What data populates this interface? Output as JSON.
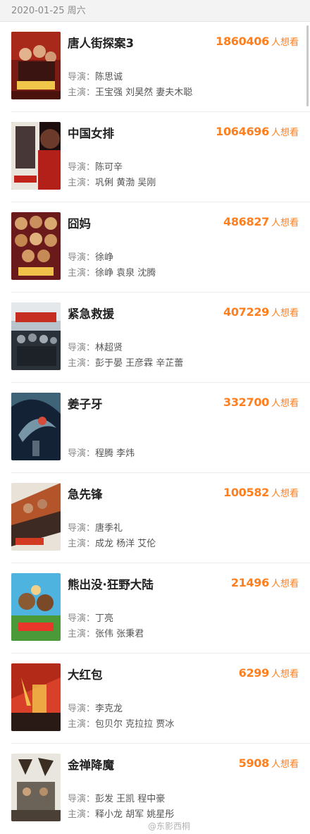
{
  "header": {
    "date": "2020-01-25 周六"
  },
  "wish_suffix": "人想看",
  "director_label": "导演：",
  "cast_label": "主演：",
  "accent_color": "#ff7f1f",
  "movies": [
    {
      "title": "唐人街探案3",
      "wish_count": "1860406",
      "director": "陈思诚",
      "cast": "王宝强 刘昊然 妻夫木聪"
    },
    {
      "title": "中国女排",
      "wish_count": "1064696",
      "director": "陈可辛",
      "cast": "巩俐 黄渤 吴刚"
    },
    {
      "title": "囧妈",
      "wish_count": "486827",
      "director": "徐峥",
      "cast": "徐峥 袁泉 沈腾"
    },
    {
      "title": "紧急救援",
      "wish_count": "407229",
      "director": "林超贤",
      "cast": "彭于晏 王彦霖 辛芷蕾"
    },
    {
      "title": "姜子牙",
      "wish_count": "332700",
      "director": "程腾 李炜",
      "cast": ""
    },
    {
      "title": "急先锋",
      "wish_count": "100582",
      "director": "唐季礼",
      "cast": "成龙 杨洋 艾伦"
    },
    {
      "title": "熊出没·狂野大陆",
      "wish_count": "21496",
      "director": "丁亮",
      "cast": "张伟 张秉君"
    },
    {
      "title": "大红包",
      "wish_count": "6299",
      "director": "李克龙",
      "cast": "包贝尔 克拉拉 贾冰"
    },
    {
      "title": "金禅降魔",
      "wish_count": "5908",
      "director": "彭发 王凯 程中豪",
      "cast": "释小龙 胡军 姚星彤"
    }
  ],
  "watermark": "@东影西桐"
}
